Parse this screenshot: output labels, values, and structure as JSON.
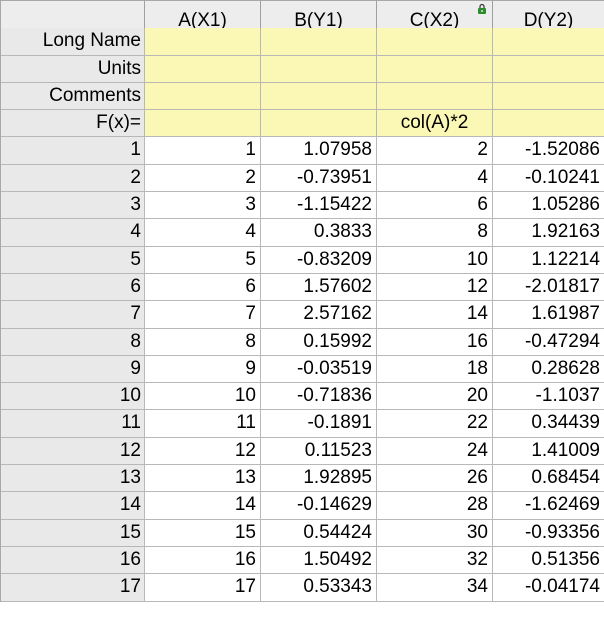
{
  "columns": [
    {
      "label": "A(X1)",
      "formula": ""
    },
    {
      "label": "B(Y1)",
      "formula": ""
    },
    {
      "label": "C(X2)",
      "formula": "col(A)*2",
      "locked": true
    },
    {
      "label": "D(Y2)",
      "formula": ""
    }
  ],
  "meta_rows": [
    "Long Name",
    "Units",
    "Comments",
    "F(x)="
  ],
  "rows": [
    {
      "n": "1",
      "cells": [
        "1",
        "1.07958",
        "2",
        "-1.52086"
      ]
    },
    {
      "n": "2",
      "cells": [
        "2",
        "-0.73951",
        "4",
        "-0.10241"
      ]
    },
    {
      "n": "3",
      "cells": [
        "3",
        "-1.15422",
        "6",
        "1.05286"
      ]
    },
    {
      "n": "4",
      "cells": [
        "4",
        "0.3833",
        "8",
        "1.92163"
      ]
    },
    {
      "n": "5",
      "cells": [
        "5",
        "-0.83209",
        "10",
        "1.12214"
      ]
    },
    {
      "n": "6",
      "cells": [
        "6",
        "1.57602",
        "12",
        "-2.01817"
      ]
    },
    {
      "n": "7",
      "cells": [
        "7",
        "2.57162",
        "14",
        "1.61987"
      ]
    },
    {
      "n": "8",
      "cells": [
        "8",
        "0.15992",
        "16",
        "-0.47294"
      ]
    },
    {
      "n": "9",
      "cells": [
        "9",
        "-0.03519",
        "18",
        "0.28628"
      ]
    },
    {
      "n": "10",
      "cells": [
        "10",
        "-0.71836",
        "20",
        "-1.1037"
      ]
    },
    {
      "n": "11",
      "cells": [
        "11",
        "-0.1891",
        "22",
        "0.34439"
      ]
    },
    {
      "n": "12",
      "cells": [
        "12",
        "0.11523",
        "24",
        "1.41009"
      ]
    },
    {
      "n": "13",
      "cells": [
        "13",
        "1.92895",
        "26",
        "0.68454"
      ]
    },
    {
      "n": "14",
      "cells": [
        "14",
        "-0.14629",
        "28",
        "-1.62469"
      ]
    },
    {
      "n": "15",
      "cells": [
        "15",
        "0.54424",
        "30",
        "-0.93356"
      ]
    },
    {
      "n": "16",
      "cells": [
        "16",
        "1.50492",
        "32",
        "0.51356"
      ]
    },
    {
      "n": "17",
      "cells": [
        "17",
        "0.53343",
        "34",
        "-0.04174"
      ]
    }
  ],
  "colors": {
    "meta_bg": "#fbf7b4",
    "header_bg": "#ededed",
    "lock_icon": "#2e8b2e"
  }
}
